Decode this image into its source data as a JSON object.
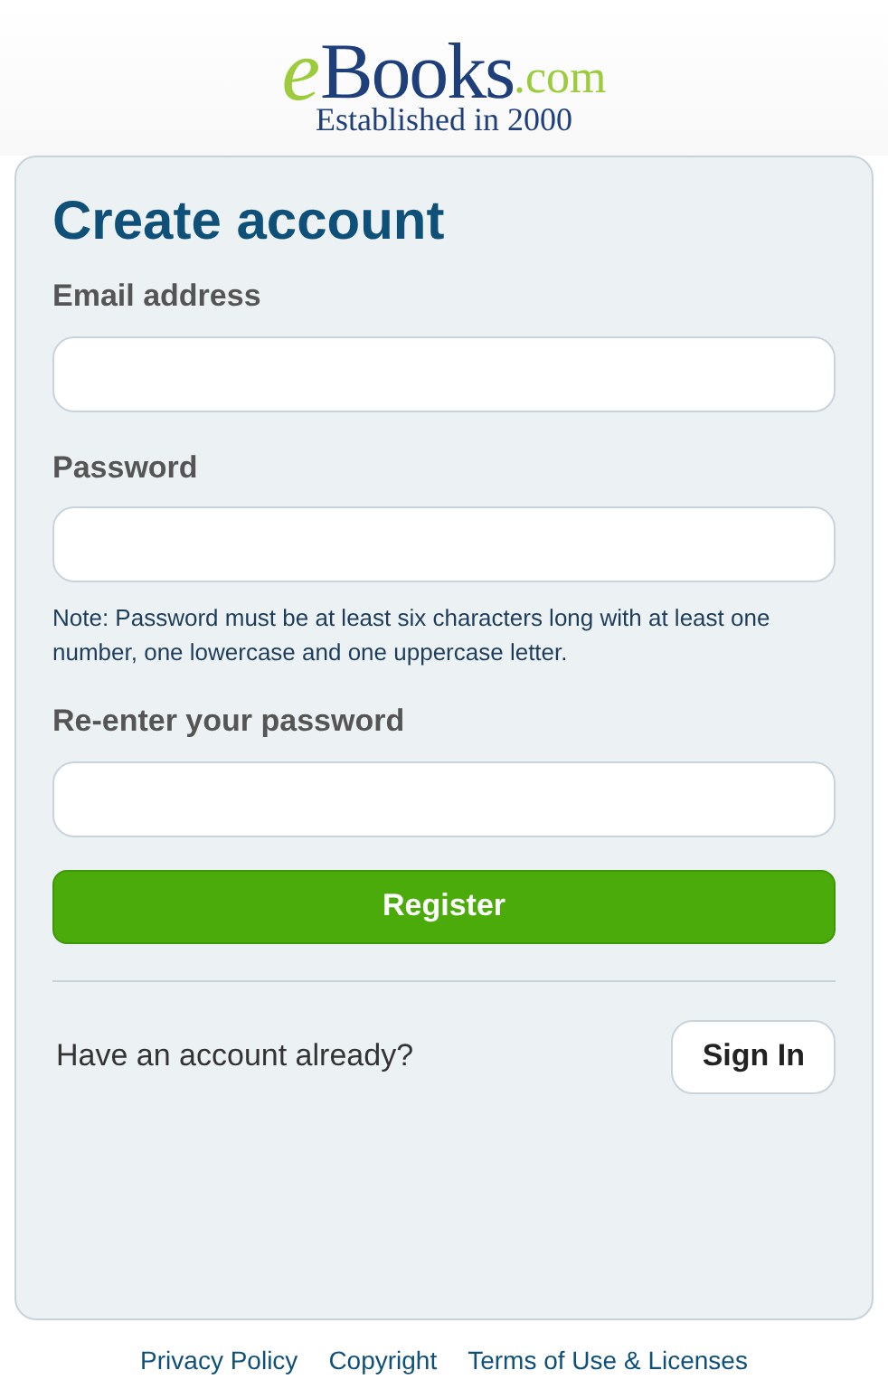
{
  "logo": {
    "letter": "e",
    "word": "Books",
    "domain": ".com",
    "tagline": "Established in 2000"
  },
  "form": {
    "title": "Create account",
    "fields": [
      {
        "label": "Email address"
      },
      {
        "label": "Password",
        "note": "Note: Password must be at least six characters long with at least one number, one lowercase and one uppercase letter."
      },
      {
        "label": "Re-enter your password"
      }
    ],
    "submit": "Register",
    "signin_prompt": "Have an account already?",
    "signin_button": "Sign In"
  },
  "footer_links": [
    "Privacy Policy",
    "Copyright",
    "Terms of Use & Licenses"
  ]
}
